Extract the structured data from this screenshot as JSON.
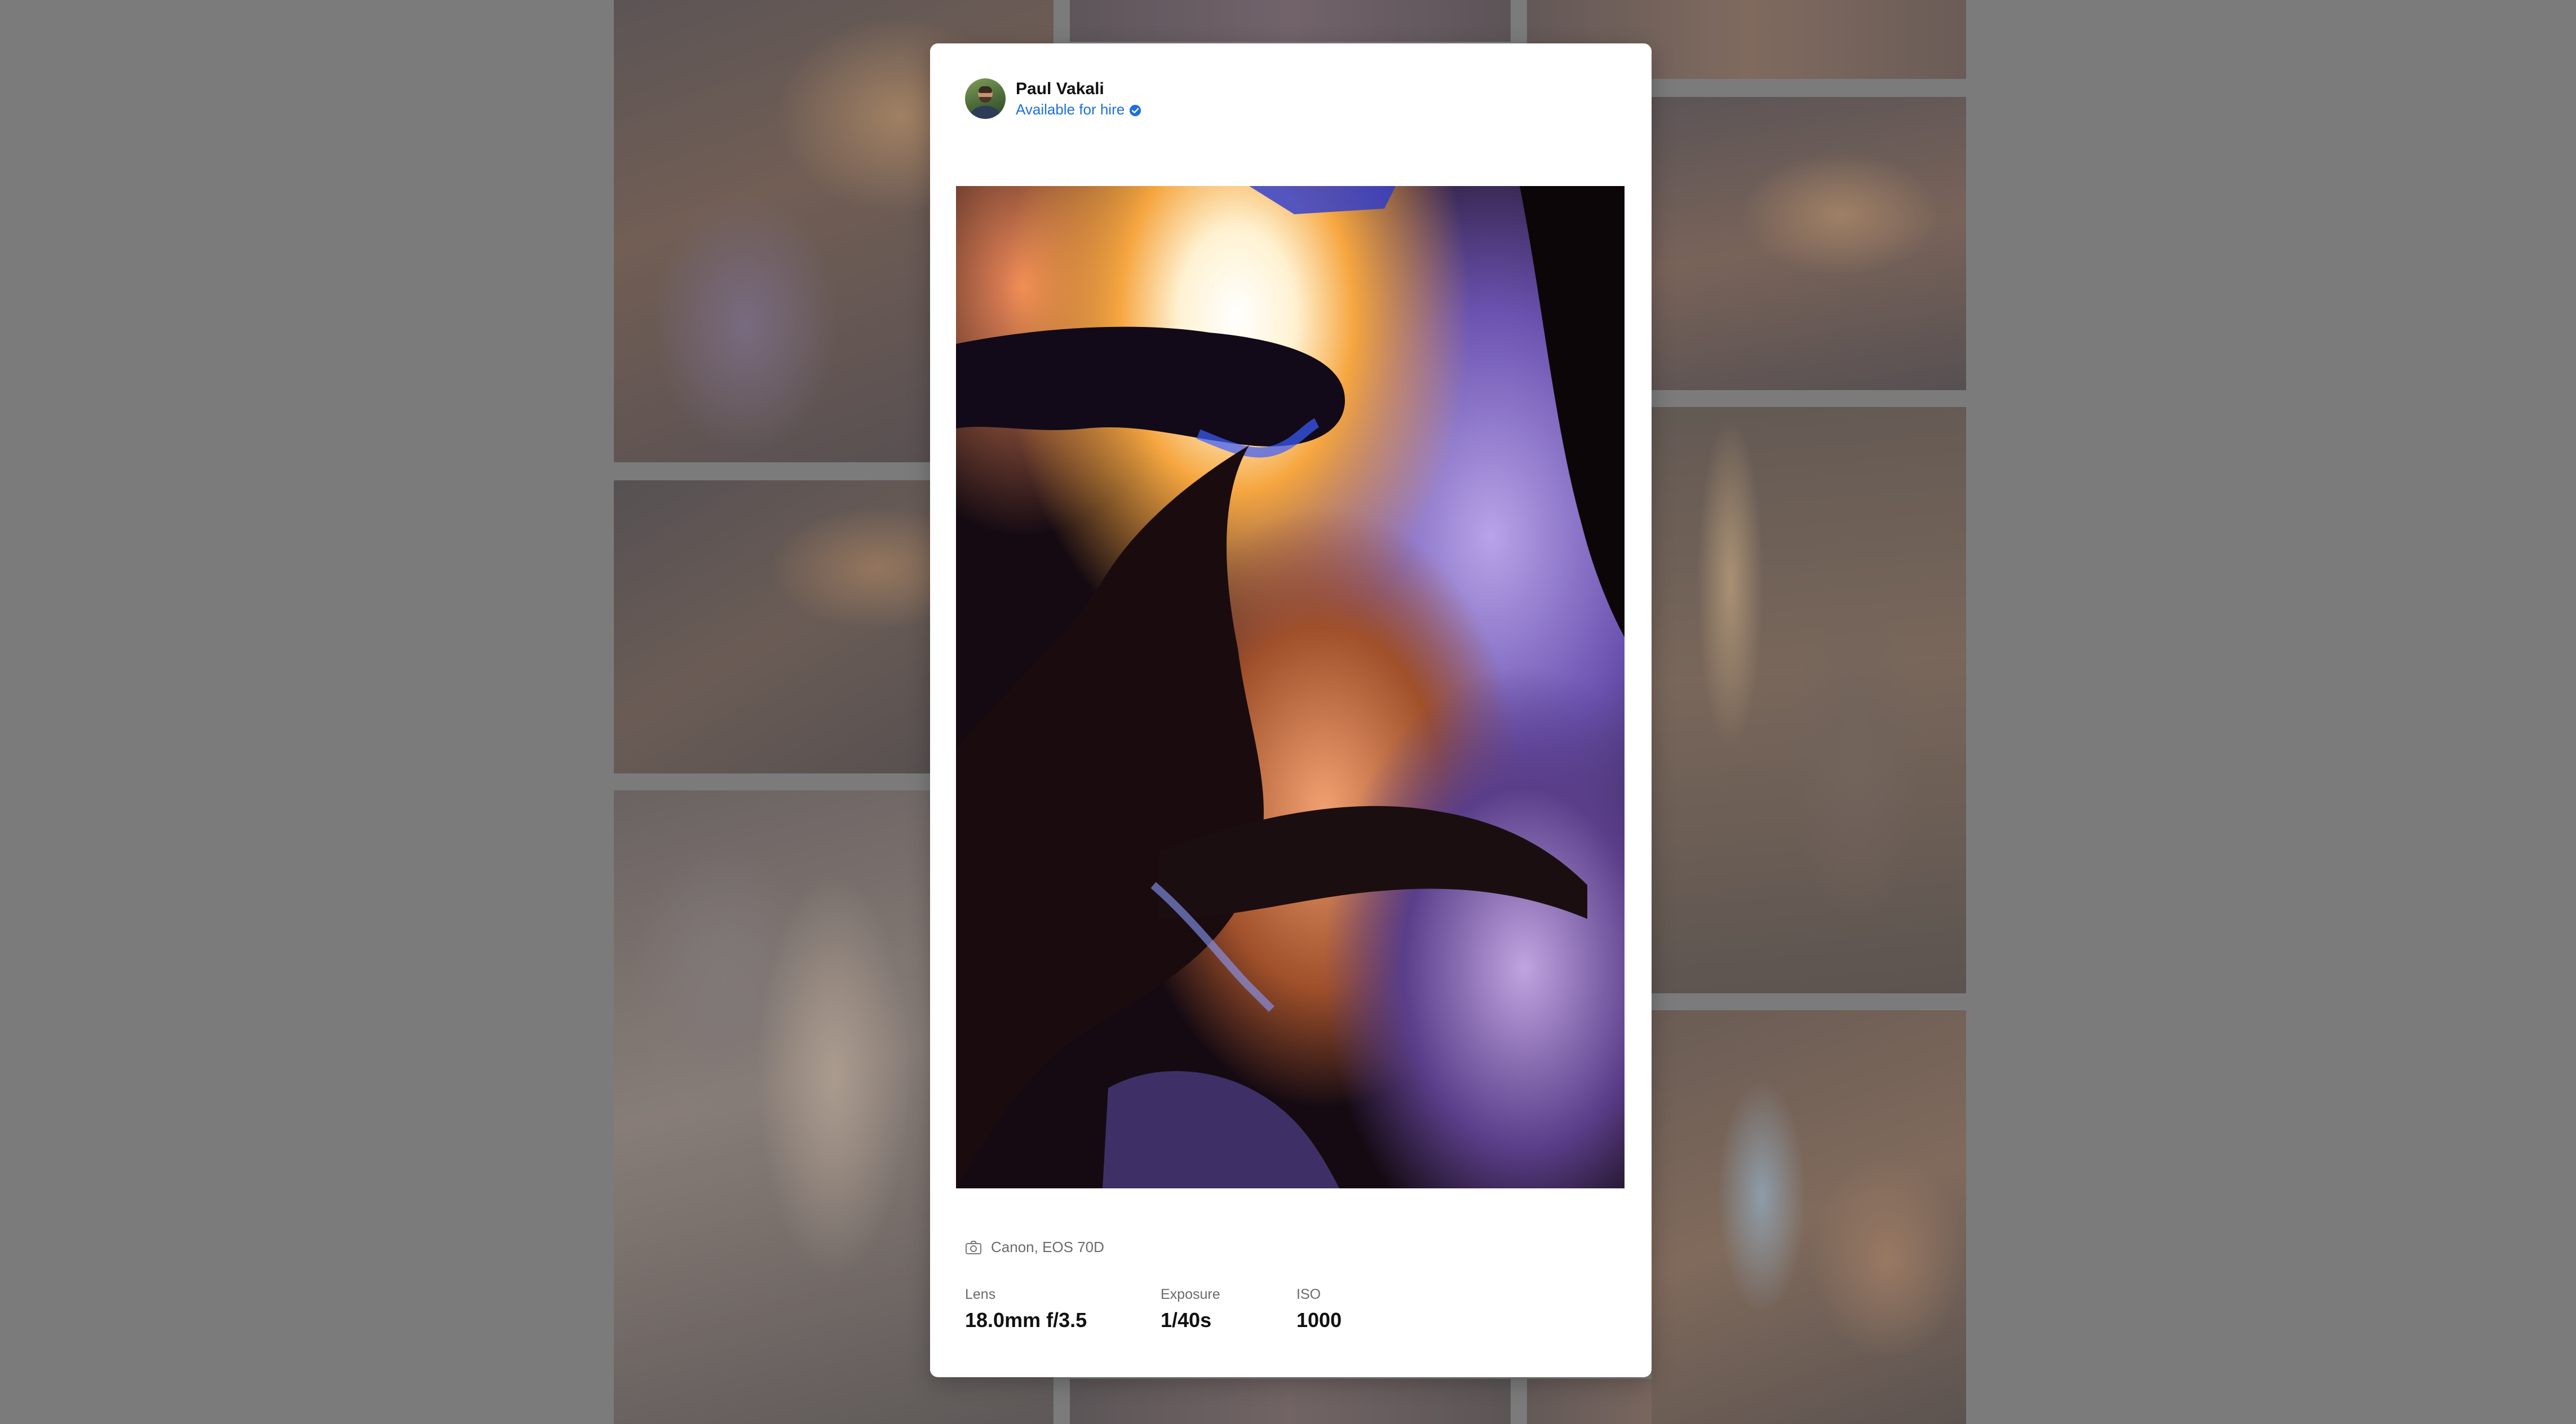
{
  "user": {
    "name": "Paul Vakali",
    "status": "Available for hire"
  },
  "photo": {
    "alt": "Antelope canyon photo"
  },
  "camera": {
    "model": "Canon, EOS 70D"
  },
  "specs": {
    "lens_label": "Lens",
    "lens_value": "18.0mm f/3.5",
    "exposure_label": "Exposure",
    "exposure_value": "1/40s",
    "iso_label": "ISO",
    "iso_value": "1000"
  },
  "colors": {
    "link": "#1e6fe0",
    "overlay": "#7b7b7b",
    "modal": "#ffffff"
  }
}
